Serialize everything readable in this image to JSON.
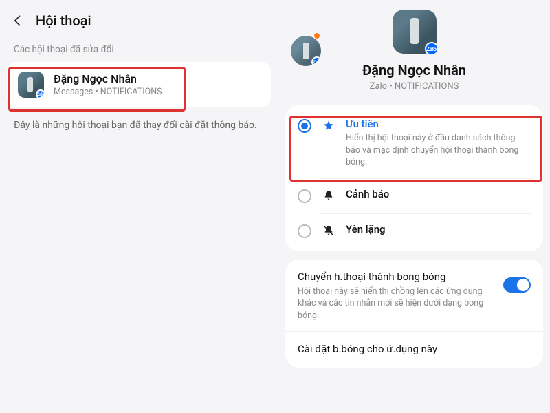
{
  "left": {
    "header_title": "Hội thoại",
    "section_label": "Các hội thoại đã sửa đổi",
    "conversation": {
      "name": "Đặng Ngọc Nhân",
      "sub": "Messages • NOTIFICATIONS"
    },
    "description": "Đây là những hội thoại bạn đã thay đổi cài đặt thông báo."
  },
  "right": {
    "contact_name": "Đặng Ngọc Nhân",
    "contact_sub": "Zalo • NOTIFICATIONS",
    "options": {
      "priority": {
        "title": "Ưu tiên",
        "desc": "Hiển thị hội thoại này ở đầu danh sách thông báo và mặc định chuyển hội thoại thành bong bóng.",
        "selected": true
      },
      "alert": {
        "title": "Cảnh báo",
        "selected": false
      },
      "silent": {
        "title": "Yên lặng",
        "selected": false
      }
    },
    "bubble": {
      "title": "Chuyển h.thoại thành bong bóng",
      "desc": "Hội thoại này sẽ hiển thị chồng lên các ứng dụng khác và các tin nhắn mới sẽ hiện dưới dạng bong bóng.",
      "on": true
    },
    "bubble_settings": "Cài đặt b.bóng cho ứ.dụng này"
  },
  "zalo_label": "Zalo"
}
